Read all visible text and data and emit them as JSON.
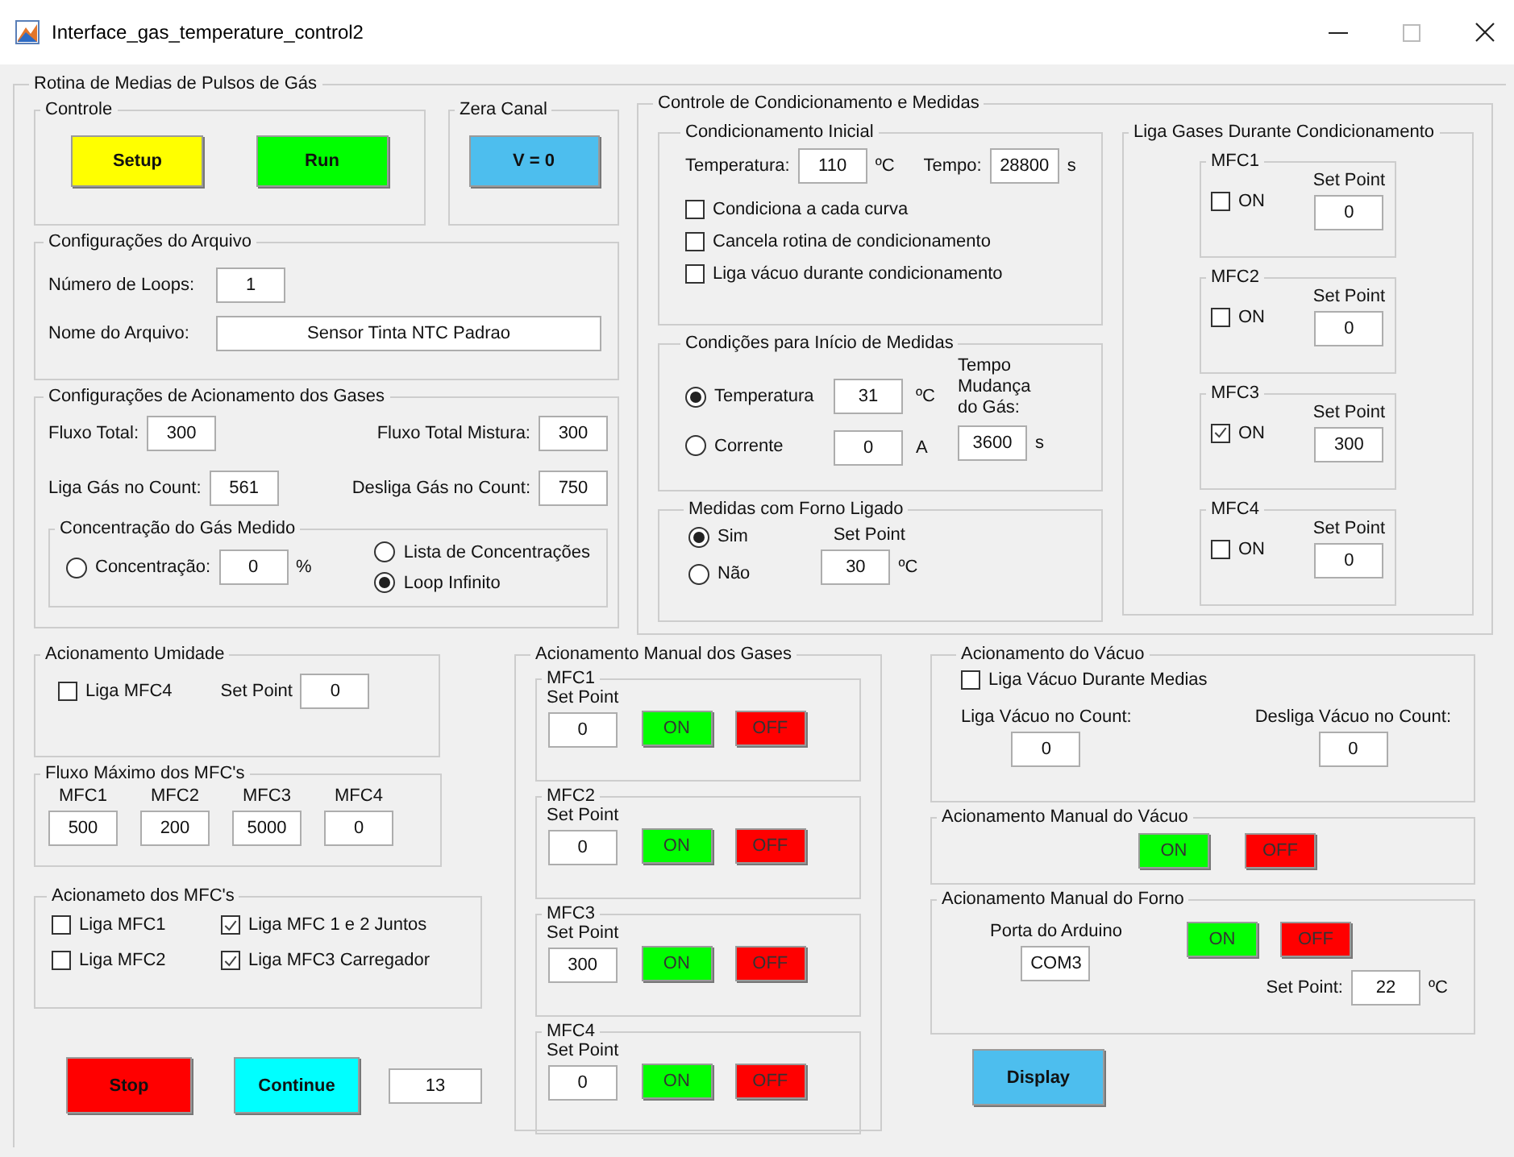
{
  "window": {
    "title": "Interface_gas_temperature_control2"
  },
  "main_panel": {
    "title": "Rotina de Medias de Pulsos de Gás"
  },
  "controle": {
    "title": "Controle",
    "buttons": [
      {
        "label": "Setup",
        "color": "#ffff00"
      },
      {
        "label": "Run",
        "color": "#00ff00"
      }
    ]
  },
  "zera_canal": {
    "title": "Zera Canal",
    "button": {
      "label": "V = 0",
      "color": "#4dbeee"
    }
  },
  "arquivo": {
    "title": "Configurações do Arquivo",
    "fields": [
      {
        "label": "Número de Loops:",
        "value": "1"
      },
      {
        "label": "Nome do Arquivo:",
        "value": "Sensor Tinta NTC Padrao"
      }
    ]
  },
  "acionamento_gases": {
    "title": "Configurações de Acionamento dos Gases",
    "fields": [
      {
        "label": "Fluxo Total:",
        "value": "300"
      },
      {
        "label": "Fluxo Total Mistura:",
        "value": "300"
      },
      {
        "label": "Liga Gás no Count:",
        "value": "561"
      },
      {
        "label": "Desliga Gás no Count:",
        "value": "750"
      }
    ],
    "concentracao": {
      "title": "Concentração do Gás Medido",
      "options": [
        {
          "label": "Concentração:",
          "selected": false,
          "value": "0",
          "unit": "%"
        },
        {
          "label": "Lista de Concentrações",
          "selected": false
        },
        {
          "label": "Loop Infinito",
          "selected": true
        }
      ]
    }
  },
  "condicionamento": {
    "title": "Controle de Condicionamento e Medidas",
    "inicial": {
      "title": "Condicionamento Inicial",
      "fields": [
        {
          "label": "Temperatura:",
          "value": "110",
          "unit": "ºC"
        },
        {
          "label": "Tempo:",
          "value": "28800",
          "unit": "s"
        }
      ],
      "checks": [
        {
          "label": "Condiciona a cada curva",
          "checked": false
        },
        {
          "label": "Cancela rotina de condicionamento",
          "checked": false
        },
        {
          "label": "Liga vácuo durante condicionamento",
          "checked": false
        }
      ]
    },
    "inicio": {
      "title": "Condições para Início de Medidas",
      "options": [
        {
          "label": "Temperatura",
          "selected": true,
          "value": "31",
          "unit": "ºC"
        },
        {
          "label": "Corrente",
          "selected": false,
          "value": "0",
          "unit": "A"
        }
      ],
      "tempo": {
        "label": "Tempo Mudança do Gás:",
        "value": "3600",
        "unit": "s"
      }
    },
    "forno": {
      "title": "Medidas com Forno Ligado",
      "options": [
        {
          "label": "Sim",
          "selected": true
        },
        {
          "label": "Não",
          "selected": false
        }
      ],
      "setpoint": {
        "label": "Set Point",
        "value": "30",
        "unit": "ºC"
      }
    },
    "liga_gases": {
      "title": "Liga Gases Durante Condicionamento",
      "mfcs": [
        {
          "title": "MFC1",
          "on_label": "ON",
          "checked": false,
          "setpoint_label": "Set Point",
          "value": "0"
        },
        {
          "title": "MFC2",
          "on_label": "ON",
          "checked": false,
          "setpoint_label": "Set Point",
          "value": "0"
        },
        {
          "title": "MFC3",
          "on_label": "ON",
          "checked": true,
          "setpoint_label": "Set Point",
          "value": "300"
        },
        {
          "title": "MFC4",
          "on_label": "ON",
          "checked": false,
          "setpoint_label": "Set Point",
          "value": "0"
        }
      ]
    }
  },
  "umidade": {
    "title": "Acionamento Umidade",
    "check": {
      "label": "Liga MFC4",
      "checked": false
    },
    "setpoint": {
      "label": "Set Point",
      "value": "0"
    }
  },
  "fluxo_max": {
    "title": "Fluxo Máximo dos MFC's",
    "items": [
      {
        "label": "MFC1",
        "value": "500"
      },
      {
        "label": "MFC2",
        "value": "200"
      },
      {
        "label": "MFC3",
        "value": "5000"
      },
      {
        "label": "MFC4",
        "value": "0"
      }
    ]
  },
  "acionamento_mfcs": {
    "title": "Acionameto dos MFC's",
    "checks": [
      {
        "label": "Liga MFC1",
        "checked": false
      },
      {
        "label": "Liga MFC 1 e 2 Juntos",
        "checked": true
      },
      {
        "label": "Liga MFC2",
        "checked": false
      },
      {
        "label": "Liga MFC3 Carregador",
        "checked": true
      }
    ]
  },
  "actions": {
    "buttons": [
      {
        "label": "Stop",
        "color": "#ff0000"
      },
      {
        "label": "Continue",
        "color": "#00ffff"
      }
    ],
    "counter": "13"
  },
  "manual_gases": {
    "title": "Acionamento Manual dos Gases",
    "mfcs": [
      {
        "title": "MFC1",
        "setpoint_label": "Set Point",
        "value": "0",
        "buttons": [
          {
            "label": "ON",
            "color": "#00ff00"
          },
          {
            "label": "OFF",
            "color": "#ff0000"
          }
        ]
      },
      {
        "title": "MFC2",
        "setpoint_label": "Set Point",
        "value": "0",
        "buttons": [
          {
            "label": "ON",
            "color": "#00ff00"
          },
          {
            "label": "OFF",
            "color": "#ff0000"
          }
        ]
      },
      {
        "title": "MFC3",
        "setpoint_label": "Set Point",
        "value": "300",
        "buttons": [
          {
            "label": "ON",
            "color": "#00ff00"
          },
          {
            "label": "OFF",
            "color": "#ff0000"
          }
        ]
      },
      {
        "title": "MFC4",
        "setpoint_label": "Set Point",
        "value": "0",
        "buttons": [
          {
            "label": "ON",
            "color": "#00ff00"
          },
          {
            "label": "OFF",
            "color": "#ff0000"
          }
        ]
      }
    ]
  },
  "vacuo": {
    "title": "Acionamento do Vácuo",
    "check": {
      "label": "Liga Vácuo Durante Medias",
      "checked": false
    },
    "fields": [
      {
        "label": "Liga Vácuo no Count:",
        "value": "0"
      },
      {
        "label": "Desliga Vácuo no Count:",
        "value": "0"
      }
    ]
  },
  "manual_vacuo": {
    "title": "Acionamento Manual do Vácuo",
    "buttons": [
      {
        "label": "ON",
        "color": "#00ff00"
      },
      {
        "label": "OFF",
        "color": "#ff0000"
      }
    ]
  },
  "manual_forno": {
    "title": "Acionamento Manual do Forno",
    "port": {
      "label": "Porta do Arduino",
      "value": "COM3"
    },
    "buttons": [
      {
        "label": "ON",
        "color": "#00ff00"
      },
      {
        "label": "OFF",
        "color": "#ff0000"
      }
    ],
    "setpoint": {
      "label": "Set Point:",
      "value": "22",
      "unit": "ºC"
    }
  },
  "display_button": {
    "label": "Display",
    "color": "#4dbeee"
  }
}
